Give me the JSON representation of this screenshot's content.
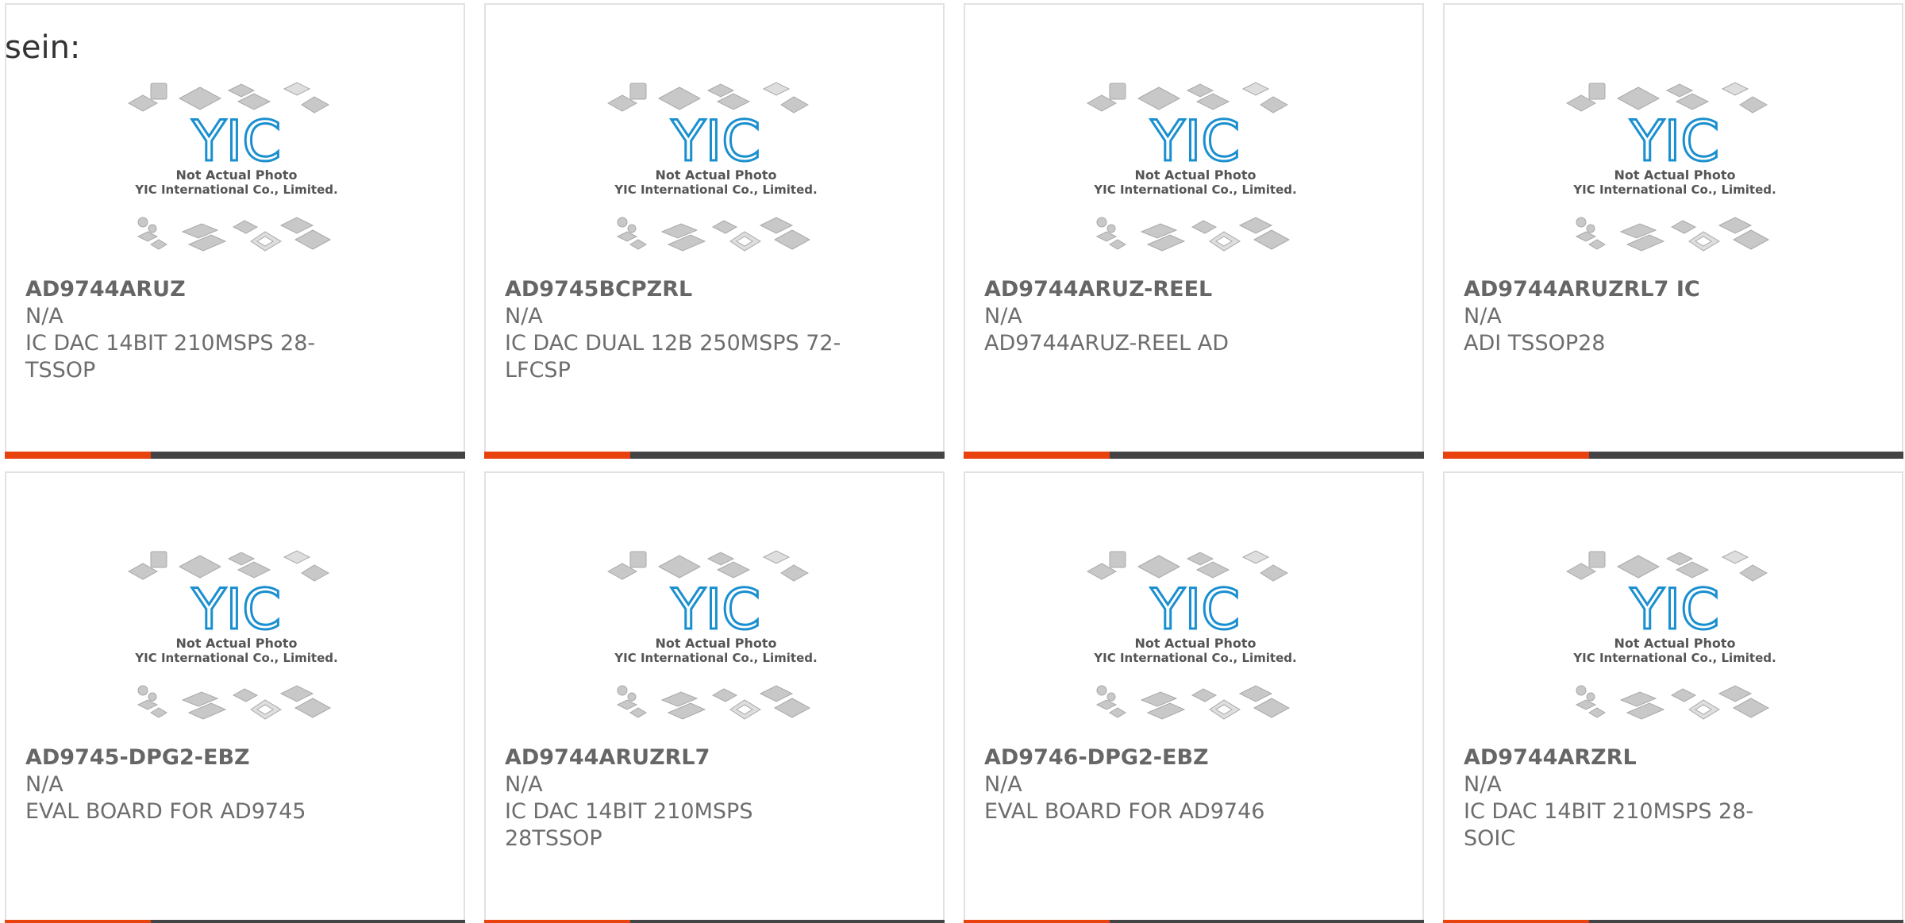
{
  "intro_text": "sein:",
  "placeholder": {
    "caption_line1": "Not Actual Photo",
    "caption_line2": "YIC International Co., Limited.",
    "logo_text": "YIC",
    "accent_color": "#e8420e",
    "bar_color": "#444444",
    "logo_color": "#1a8fd0"
  },
  "products": [
    {
      "part": "AD9744ARUZ",
      "mfr": "N/A",
      "desc_lines": [
        "IC DAC 14BIT 210MSPS 28-",
        "TSSOP"
      ]
    },
    {
      "part": "AD9745BCPZRL",
      "mfr": "N/A",
      "desc_lines": [
        "IC DAC DUAL 12B 250MSPS 72-",
        "LFCSP"
      ]
    },
    {
      "part": "AD9744ARUZ-REEL",
      "mfr": "N/A",
      "desc_lines": [
        "AD9744ARUZ-REEL AD",
        ""
      ]
    },
    {
      "part": "AD9744ARUZRL7 IC",
      "mfr": "N/A",
      "desc_lines": [
        "ADI TSSOP28",
        ""
      ]
    },
    {
      "part": "AD9745-DPG2-EBZ",
      "mfr": "N/A",
      "desc_lines": [
        "EVAL BOARD FOR AD9745",
        ""
      ]
    },
    {
      "part": "AD9744ARUZRL7",
      "mfr": "N/A",
      "desc_lines": [
        "IC DAC 14BIT 210MSPS 28TSSOP",
        ""
      ]
    },
    {
      "part": "AD9746-DPG2-EBZ",
      "mfr": "N/A",
      "desc_lines": [
        "EVAL BOARD FOR AD9746",
        ""
      ]
    },
    {
      "part": "AD9744ARZRL",
      "mfr": "N/A",
      "desc_lines": [
        "IC DAC 14BIT 210MSPS 28-SOIC",
        ""
      ]
    }
  ]
}
